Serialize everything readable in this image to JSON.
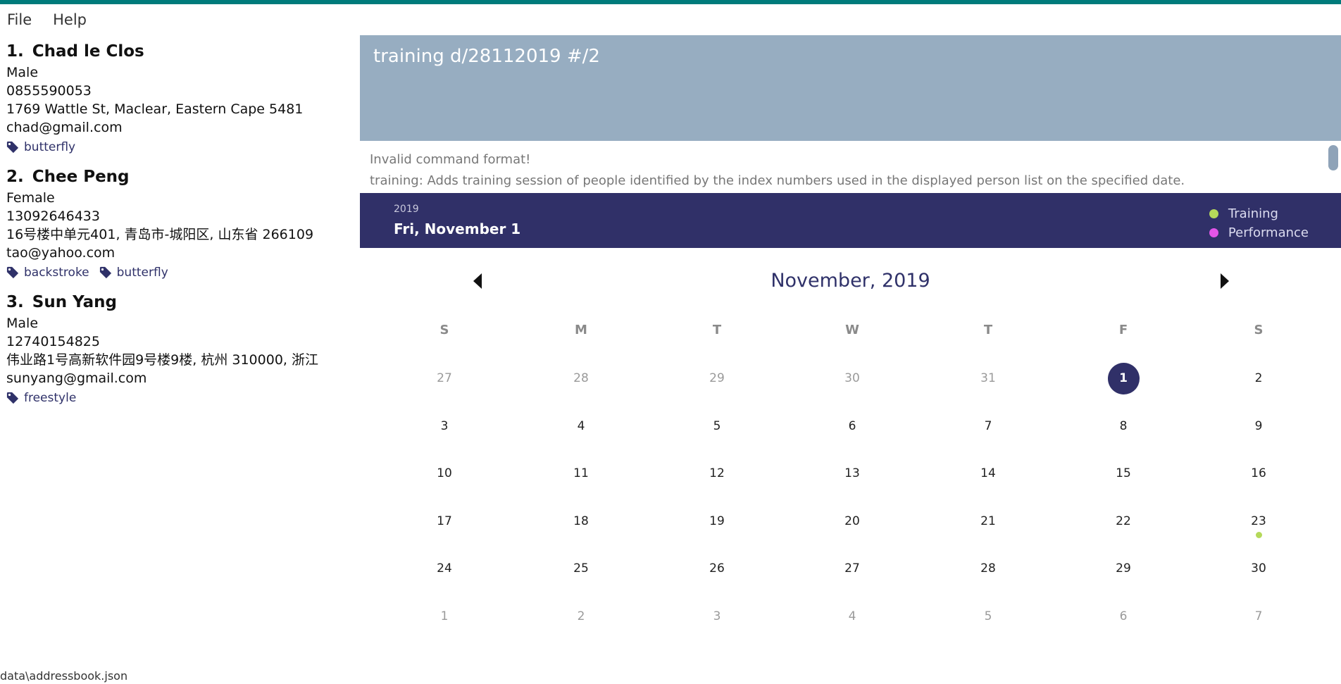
{
  "menu": {
    "file": "File",
    "help": "Help"
  },
  "persons": [
    {
      "index": "1.",
      "name": "Chad le Clos",
      "gender": "Male",
      "phone": "0855590053",
      "address": "1769 Wattle St, Maclear, Eastern Cape 5481",
      "email": "chad@gmail.com",
      "tags": [
        "butterfly"
      ]
    },
    {
      "index": "2.",
      "name": "Chee Peng",
      "gender": "Female",
      "phone": "13092646433",
      "address": "16号楼中单元401, 青岛市-城阳区, 山东省 266109",
      "email": "tao@yahoo.com",
      "tags": [
        "backstroke",
        "butterfly"
      ]
    },
    {
      "index": "3.",
      "name": "Sun Yang",
      "gender": "Male",
      "phone": "12740154825",
      "address": "伟业路1号高新软件园9号楼9楼, 杭州 310000, 浙江",
      "email": "sunyang@gmail.com",
      "tags": [
        "freestyle"
      ]
    }
  ],
  "command": {
    "value": "training d/28112019 #/2"
  },
  "result": {
    "line1": "Invalid command format!",
    "line2": "training: Adds training session of people identified by the index numbers used in the displayed person list on the specified date."
  },
  "calendar": {
    "year": "2019",
    "selected_date": "Fri, November 1",
    "month_title": "November, 2019",
    "legend": [
      {
        "label": "Training",
        "color": "#b5d95a"
      },
      {
        "label": "Performance",
        "color": "#e355e8"
      }
    ],
    "day_headers": [
      "S",
      "M",
      "T",
      "W",
      "T",
      "F",
      "S"
    ],
    "selected_day": "1",
    "event_day": "23",
    "event_color": "#b5d95a",
    "weeks": [
      [
        {
          "d": "27",
          "o": true
        },
        {
          "d": "28",
          "o": true
        },
        {
          "d": "29",
          "o": true
        },
        {
          "d": "30",
          "o": true
        },
        {
          "d": "31",
          "o": true
        },
        {
          "d": "1",
          "o": false
        },
        {
          "d": "2",
          "o": false
        }
      ],
      [
        {
          "d": "3",
          "o": false
        },
        {
          "d": "4",
          "o": false
        },
        {
          "d": "5",
          "o": false
        },
        {
          "d": "6",
          "o": false
        },
        {
          "d": "7",
          "o": false
        },
        {
          "d": "8",
          "o": false
        },
        {
          "d": "9",
          "o": false
        }
      ],
      [
        {
          "d": "10",
          "o": false
        },
        {
          "d": "11",
          "o": false
        },
        {
          "d": "12",
          "o": false
        },
        {
          "d": "13",
          "o": false
        },
        {
          "d": "14",
          "o": false
        },
        {
          "d": "15",
          "o": false
        },
        {
          "d": "16",
          "o": false
        }
      ],
      [
        {
          "d": "17",
          "o": false
        },
        {
          "d": "18",
          "o": false
        },
        {
          "d": "19",
          "o": false
        },
        {
          "d": "20",
          "o": false
        },
        {
          "d": "21",
          "o": false
        },
        {
          "d": "22",
          "o": false
        },
        {
          "d": "23",
          "o": false
        }
      ],
      [
        {
          "d": "24",
          "o": false
        },
        {
          "d": "25",
          "o": false
        },
        {
          "d": "26",
          "o": false
        },
        {
          "d": "27",
          "o": false
        },
        {
          "d": "28",
          "o": false
        },
        {
          "d": "29",
          "o": false
        },
        {
          "d": "30",
          "o": false
        }
      ],
      [
        {
          "d": "1",
          "o": true
        },
        {
          "d": "2",
          "o": true
        },
        {
          "d": "3",
          "o": true
        },
        {
          "d": "4",
          "o": true
        },
        {
          "d": "5",
          "o": true
        },
        {
          "d": "6",
          "o": true
        },
        {
          "d": "7",
          "o": true
        }
      ]
    ]
  },
  "status": {
    "path": "data\\addressbook.json"
  }
}
